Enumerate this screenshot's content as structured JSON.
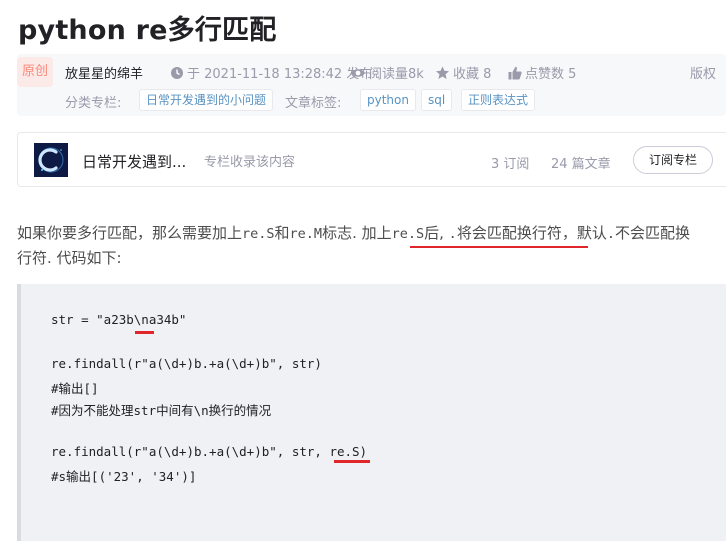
{
  "article": {
    "title": "python re多行匹配"
  },
  "meta": {
    "badge": "原创",
    "author": "放星星的绵羊",
    "date": "于 2021-11-18 13:28:42 发布",
    "reads": "阅读量8k",
    "favorites": "收藏 8",
    "likes": "点赞数 5",
    "copyright": "版权",
    "category_label": "分类专栏:",
    "category": "日常开发遇到的小问题",
    "tags_label": "文章标签:",
    "tags": [
      "python",
      "sql",
      "正则表达式"
    ]
  },
  "column": {
    "name": "日常开发遇到...",
    "desc": "专栏收录该内容",
    "subscriptions": "3 订阅",
    "articles": "24 篇文章",
    "subscribe_button": "订阅专栏"
  },
  "body": {
    "p1_a": "如果你要多行匹配，那么需要加上",
    "p1_b": "re.S",
    "p1_c": "和",
    "p1_d": "re.M",
    "p1_e": "标志. 加上",
    "p1_f": "re.S",
    "p1_g": "后, ",
    "p1_h": ".",
    "p1_i": "将会匹配换行符",
    "p1_j": "，默认",
    "p1_k": ".",
    "p1_l": "不会匹配换",
    "p2": "行符. 代码如下:"
  },
  "code": {
    "lines": [
      "str = \"a23b\\na34b\"",
      "re.findall(r\"a(\\d+)b.+a(\\d+)b\", str)",
      "#输出[]",
      "#因为不能处理str中间有\\n换行的情况",
      "re.findall(r\"a(\\d+)b.+a(\\d+)b\", str, re.S)",
      "#s输出[('23', '34')]"
    ]
  },
  "colors": {
    "accent_red": "#e0262a",
    "tag_blue": "#5893c2",
    "muted": "#999aaa",
    "badge_bg": "#fceae8",
    "badge_fg": "#f98a7a"
  }
}
